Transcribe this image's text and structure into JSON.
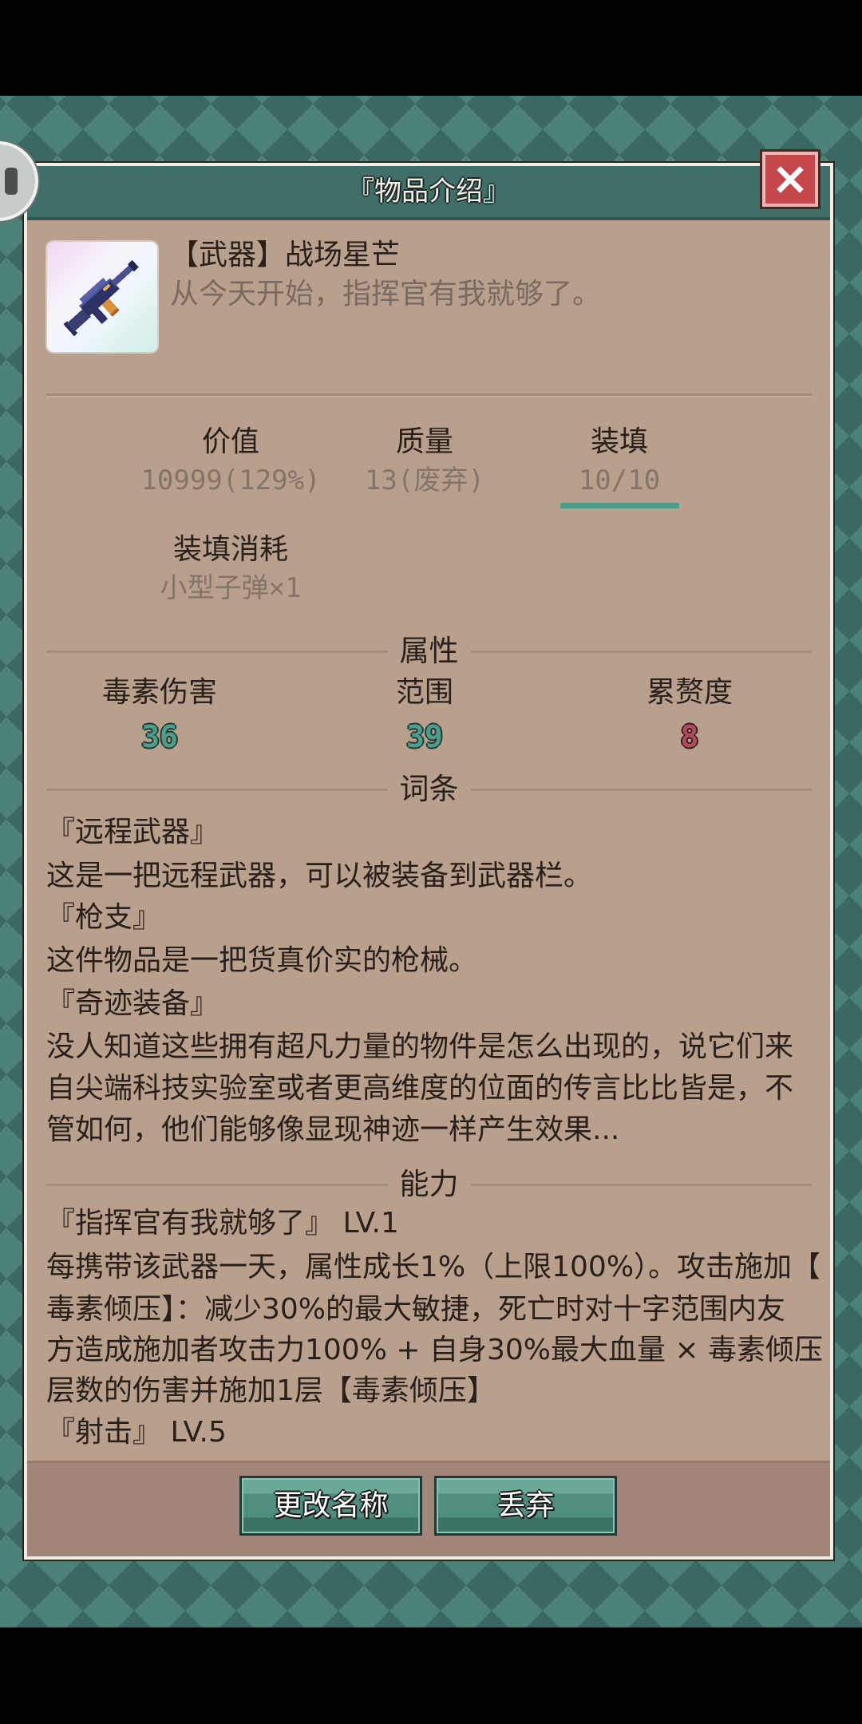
{
  "window": {
    "title": "『物品介绍』"
  },
  "icons": {
    "close": "close-icon",
    "item": "rifle-icon",
    "side": "side-handle-icon"
  },
  "item": {
    "name": "【武器】战场星芒",
    "quote": "从今天开始，指挥官有我就够了。"
  },
  "stats": {
    "value": {
      "label": "价值",
      "value": "10999(129%)"
    },
    "quality": {
      "label": "质量",
      "value": "13(废弃)"
    },
    "reload": {
      "label": "装填",
      "value": "10/10",
      "fill": 1.0
    },
    "reload_cost": {
      "label": "装填消耗",
      "value": "小型子弹×1"
    }
  },
  "attributes": {
    "title": "属性",
    "items": [
      {
        "label": "毒素伤害",
        "value": "36"
      },
      {
        "label": "范围",
        "value": "39"
      },
      {
        "label": "累赘度",
        "value": "8"
      }
    ]
  },
  "entries": {
    "title": "词条",
    "items": [
      {
        "name": "『远程武器』",
        "lines": [
          "这是一把远程武器，可以被装备到武器栏。"
        ]
      },
      {
        "name": "『枪支』",
        "lines": [
          "这件物品是一把货真价实的枪械。"
        ]
      },
      {
        "name": "『奇迹装备』",
        "lines": [
          "没人知道这些拥有超凡力量的物件是怎么出现的，说它们来",
          "自尖端科技实验室或者更高维度的位面的传言比比皆是，不",
          "管如何，他们能够像显现神迹一样产生效果..."
        ]
      }
    ]
  },
  "abilities": {
    "title": "能力",
    "items": [
      {
        "name": "『指挥官有我就够了』 LV.1",
        "lines": [
          "每携带该武器一天，属性成长1%（上限100%）。攻击施加【",
          "毒素倾压】：减少30%的最大敏捷，死亡时对十字范围内友",
          "方造成施加者攻击力100% + 自身30%最大血量 × 毒素倾压",
          "层数的伤害并施加1层【毒素倾压】"
        ]
      },
      {
        "name": "『射击』 LV.5",
        "lines": []
      }
    ]
  },
  "buttons": {
    "rename": "更改名称",
    "discard": "丢弃"
  },
  "colors": {
    "panel": "#b8a08c",
    "header": "#3f6f68",
    "accent": "#4f9c8b",
    "burden": "#b04c5e",
    "close_button": "#c5474c",
    "text": "#2a201b",
    "muted_text": "#7b6a60"
  }
}
